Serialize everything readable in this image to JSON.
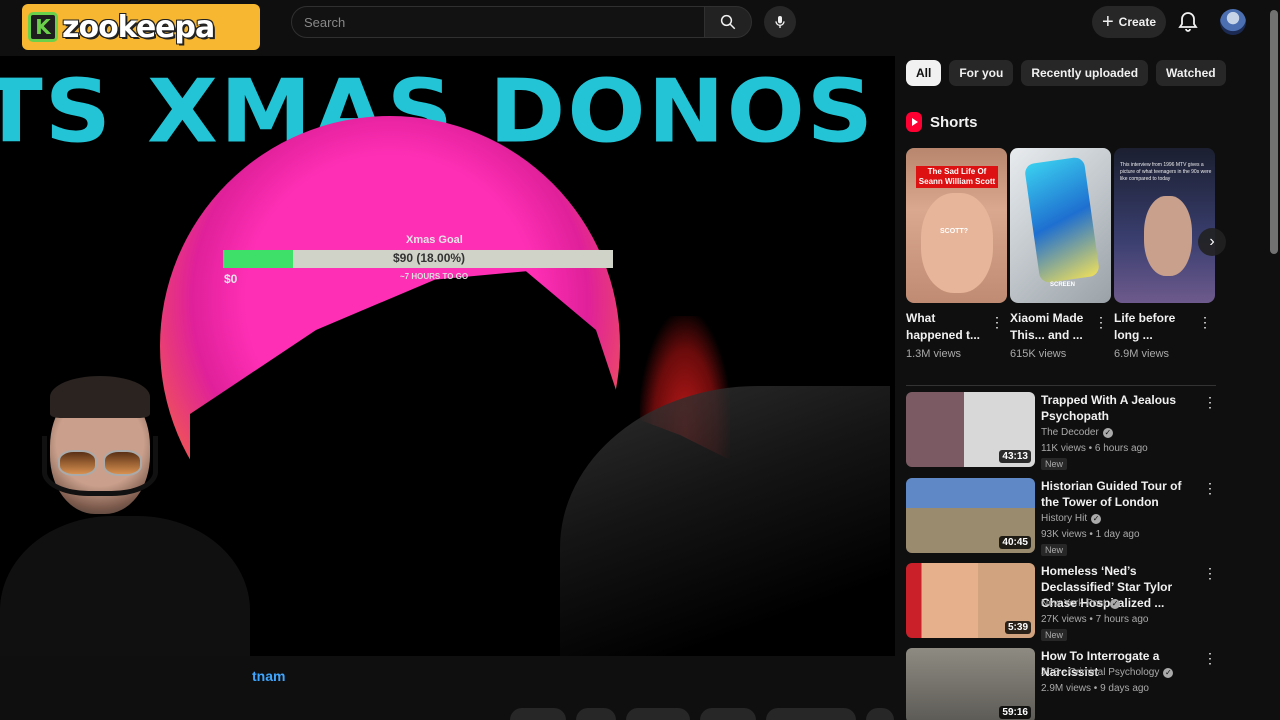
{
  "header": {
    "logo_text": "zookeepa",
    "logo_letter": "K",
    "search_placeholder": "Search",
    "create_label": "Create"
  },
  "video": {
    "overlay_title": "TS XMAS DONOS",
    "goal_label": "Xmas Goal",
    "goal_amount": "$90 (18.00%)",
    "goal_progress": 0.18,
    "goal_start": "$0",
    "goal_sub": "~7 HOURS TO GO",
    "channel_link": "tnam"
  },
  "filters": {
    "chips": [
      "All",
      "For you",
      "Recently uploaded",
      "Watched"
    ],
    "active": "All"
  },
  "shorts": {
    "heading": "Shorts",
    "items": [
      {
        "title": "What happened t...",
        "views": "1.3M views",
        "thumb_text": "The Sad Life Of Seann William Scott",
        "thumb_sub": "SCOTT?"
      },
      {
        "title": "Xiaomi Made This... and ...",
        "views": "615K views",
        "thumb_text": "SCREEN"
      },
      {
        "title": "Life before long ...",
        "views": "6.9M views",
        "thumb_text": "This interview from 1996 MTV gives a picture of what teenagers in the 90s were like compared to today"
      }
    ]
  },
  "recommendations": [
    {
      "title": "Trapped With A Jealous Psychopath",
      "channel": "The Decoder",
      "meta": "11K views • 6 hours ago",
      "badge": "New",
      "duration": "43:13"
    },
    {
      "title": "Historian Guided Tour of the Tower of London",
      "channel": "History Hit",
      "meta": "93K views • 1 day ago",
      "badge": "New",
      "duration": "40:45"
    },
    {
      "title": "Homeless ‘Ned’s Declassified’ Star Tylor Chase Hospitalized ...",
      "channel": "New York Post",
      "meta": "27K views • 7 hours ago",
      "badge": "New",
      "duration": "5:39"
    },
    {
      "title": "How To Interrogate a Narcissist",
      "channel": "JCS - Criminal Psychology",
      "meta": "2.9M views • 9 days ago",
      "badge": "",
      "duration": "59:16"
    }
  ],
  "icons": {
    "search": "search-icon",
    "mic": "mic-icon",
    "bell": "bell-icon",
    "more": "more-vert-icon",
    "next": "chevron-right-icon"
  },
  "colors": {
    "background": "#0f0f0f",
    "accent_link": "#3ea6ff",
    "overlay_title": "#22c4d6",
    "goal_fill": "#3fe06a",
    "shorts_red": "#ff0033"
  }
}
